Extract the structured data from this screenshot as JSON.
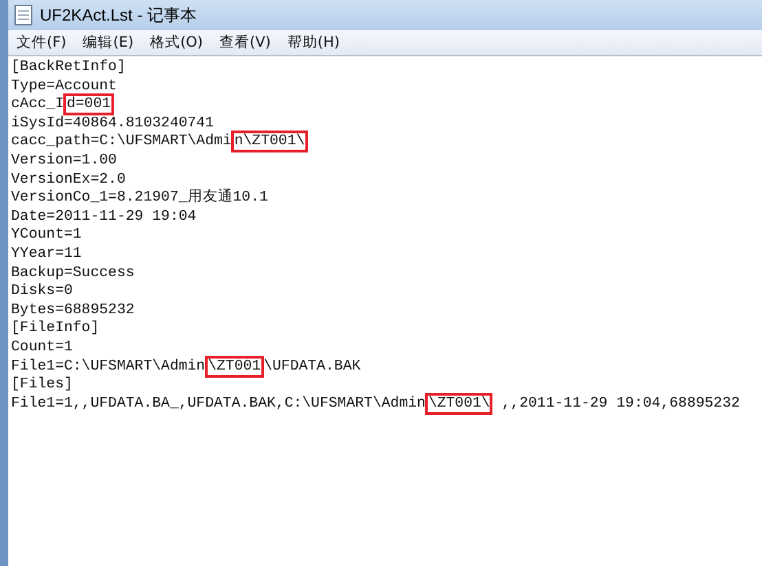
{
  "window": {
    "title": "UF2KAct.Lst - 记事本"
  },
  "menu": [
    "文件(F)",
    "编辑(E)",
    "格式(O)",
    "查看(V)",
    "帮助(H)"
  ],
  "lines": [
    [
      {
        "text": "[BackRetInfo]",
        "highlight": false
      }
    ],
    [
      {
        "text": "Type=Account",
        "highlight": false
      }
    ],
    [
      {
        "text": "cAcc_I",
        "highlight": false
      },
      {
        "text": "d=001",
        "highlight": true
      }
    ],
    [
      {
        "text": "iSysId=40864.8103240741",
        "highlight": false
      }
    ],
    [
      {
        "text": "cacc_path=C:\\UFSMART\\Admi",
        "highlight": false
      },
      {
        "text": "n\\ZT001\\",
        "highlight": true
      }
    ],
    [
      {
        "text": "Version=1.00",
        "highlight": false
      }
    ],
    [
      {
        "text": "VersionEx=2.0",
        "highlight": false
      }
    ],
    [
      {
        "text": "VersionCo_1=8.21907_用友通10.1",
        "highlight": false
      }
    ],
    [
      {
        "text": "Date=2011-11-29 19:04",
        "highlight": false
      }
    ],
    [
      {
        "text": "YCount=1",
        "highlight": false
      }
    ],
    [
      {
        "text": "YYear=11",
        "highlight": false
      }
    ],
    [
      {
        "text": "Backup=Success",
        "highlight": false
      }
    ],
    [
      {
        "text": "Disks=0",
        "highlight": false
      }
    ],
    [
      {
        "text": "Bytes=68895232",
        "highlight": false
      }
    ],
    [
      {
        "text": "[FileInfo]",
        "highlight": false
      }
    ],
    [
      {
        "text": "Count=1",
        "highlight": false
      }
    ],
    [
      {
        "text": "File1=C:\\UFSMART\\Admin",
        "highlight": false
      },
      {
        "text": "\\ZT001",
        "highlight": true
      },
      {
        "text": "\\UFDATA.BAK",
        "highlight": false
      }
    ],
    [
      {
        "text": "[Files]",
        "highlight": false
      }
    ],
    [
      {
        "text": "File1=1,,UFDATA.BA_,UFDATA.BAK,C:\\UFSMART\\Admin",
        "highlight": false
      },
      {
        "text": "\\ZT001\\",
        "highlight": true
      },
      {
        "text": " ,,2011-11-29 19:04,68895232",
        "highlight": false
      }
    ]
  ]
}
